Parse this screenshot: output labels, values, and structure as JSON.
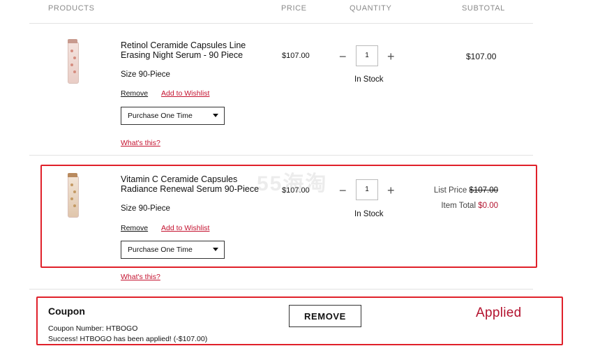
{
  "headers": {
    "products": "PRODUCTS",
    "price": "PRICE",
    "quantity": "QUANTITY",
    "subtotal": "SUBTOTAL"
  },
  "items": [
    {
      "name": "Retinol Ceramide Capsules Line Erasing Night Serum - 90 Piece",
      "size": "Size 90-Piece",
      "remove_label": "Remove",
      "wishlist_label": "Add to Wishlist",
      "purchase_option": "Purchase One Time",
      "whats_this": "What's this?",
      "price": "$107.00",
      "quantity": "1",
      "minus": "−",
      "plus": "+",
      "stock": "In Stock",
      "subtotal": "$107.00"
    },
    {
      "name": "Vitamin C Ceramide Capsules Radiance Renewal Serum 90-Piece",
      "size": "Size 90-Piece",
      "remove_label": "Remove",
      "wishlist_label": "Add to Wishlist",
      "purchase_option": "Purchase One Time",
      "whats_this": "What's this?",
      "price": "$107.00",
      "quantity": "1",
      "minus": "−",
      "plus": "+",
      "stock": "In Stock",
      "list_price_label": "List Price",
      "list_price": "$107.00",
      "item_total_label": "Item Total",
      "item_total": "$0.00"
    }
  ],
  "watermark": "55海淘",
  "coupon": {
    "title": "Coupon",
    "number_line": "Coupon Number: HTBOGO",
    "success_line": "Success! HTBOGO has been applied! (-$107.00)",
    "remove_button": "REMOVE",
    "applied_annotation": "Applied"
  },
  "colors": {
    "accent_red": "#c4122f",
    "highlight_box": "#e0202a",
    "applied_text": "#b3122e"
  }
}
